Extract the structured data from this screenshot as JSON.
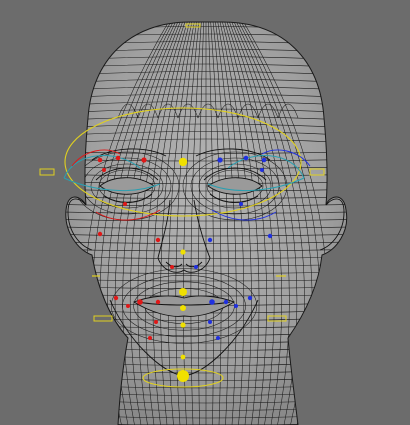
{
  "viewport": {
    "background": "#6c6c6c",
    "mesh_fill": "#a7a7a7",
    "mesh_shadow": "#7d7d7d",
    "wire_color": "#1a1a1a",
    "rig_colors": {
      "left_side": "#e01818",
      "right_side": "#2030e0",
      "center": "#f0e000",
      "eye_ring": "#2a9fb0"
    }
  },
  "scene": {
    "object": "head-mesh",
    "display_mode": "wireframe-on-shaded",
    "rig": "facial-controls"
  }
}
